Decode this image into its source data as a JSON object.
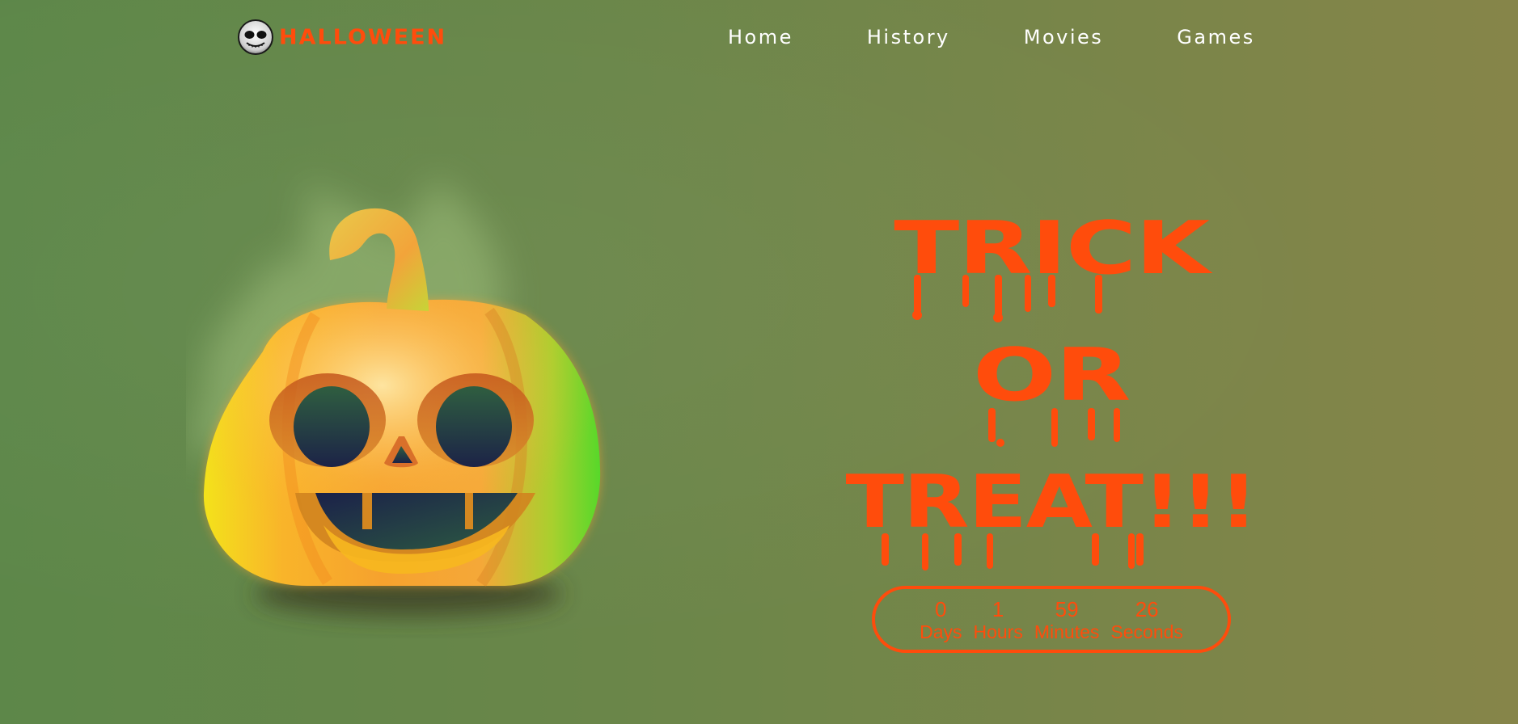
{
  "header": {
    "logo_text": "HALLOWEEN",
    "logo_icon": "skull-icon",
    "nav": [
      {
        "label": "Home"
      },
      {
        "label": "History"
      },
      {
        "label": "Movies"
      },
      {
        "label": "Games"
      }
    ]
  },
  "hero": {
    "image": "jack-o-lantern-pumpkin",
    "headline": [
      "TRICK",
      "OR",
      "TREAT!!!"
    ],
    "countdown": {
      "days": {
        "value": "0",
        "label": "Days"
      },
      "hours": {
        "value": "1",
        "label": "Hours"
      },
      "minutes": {
        "value": "59",
        "label": "Minutes"
      },
      "seconds": {
        "value": "26",
        "label": "Seconds"
      }
    }
  },
  "colors": {
    "accent": "#ff4c0c",
    "background_start": "#5d8749",
    "background_end": "#868549",
    "nav_text": "#ffffff"
  }
}
